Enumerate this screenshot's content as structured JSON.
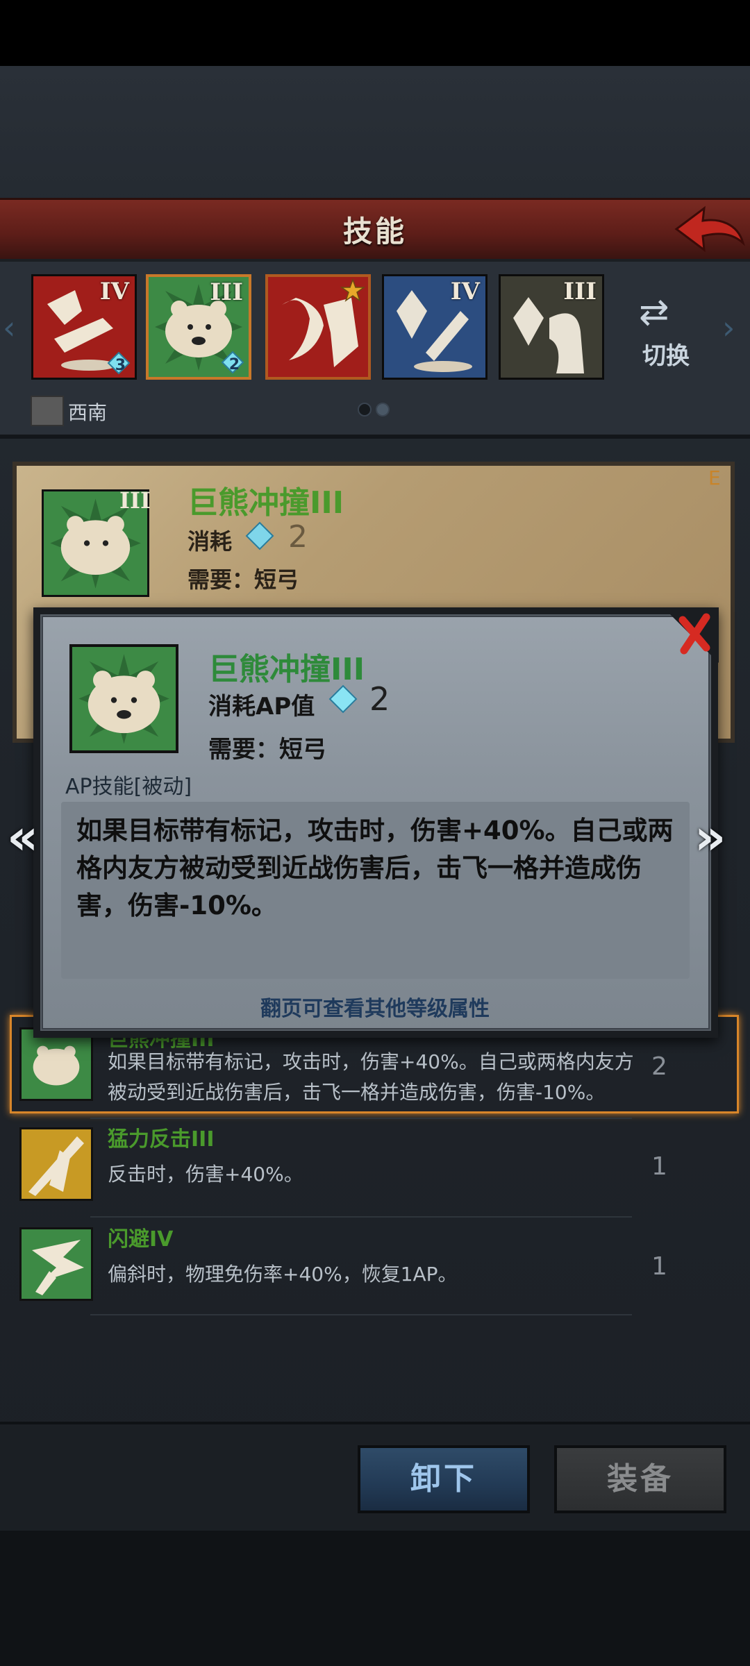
{
  "header": {
    "title": "技能"
  },
  "skill_strip": {
    "slots": [
      {
        "roman": "IV",
        "gem_count": "3",
        "art": "claw-sword"
      },
      {
        "roman": "III",
        "gem_count": "2",
        "art": "bear"
      },
      {
        "roman": "",
        "gem_count": "",
        "art": "claw-fang"
      },
      {
        "roman": "IV",
        "gem_count": "",
        "art": "crystal-sword"
      },
      {
        "roman": "III",
        "gem_count": "",
        "art": "crystal-arm"
      }
    ],
    "switch_label": "切换",
    "region_label": "西南",
    "page_dots": 2,
    "active_dot": 1
  },
  "detail_panel": {
    "title": "巨熊冲撞III",
    "roman": "III",
    "cost_label": "消耗",
    "cost_value": "2",
    "requirement": "需要：短弓",
    "corner_tag": "E"
  },
  "modal": {
    "roman": "III",
    "title": "巨熊冲撞III",
    "cost_label": "消耗AP值",
    "cost_value": "2",
    "requirement": "需要：短弓",
    "type_label": "AP技能[被动]",
    "description": "如果目标带有标记，攻击时，伤害+40%。自己或两格内友方被动受到近战伤害后，击飞一格并造成伤害，伤害-10%。",
    "hint": "翻页可查看其他等级属性"
  },
  "skill_list": [
    {
      "name": "巨熊冲撞III",
      "description": "如果目标带有标记，攻击时，伤害+40%。自己或两格内友方被动受到近战伤害后，击飞一格并造成伤害，伤害-10%。",
      "level": "2",
      "highlight": true
    },
    {
      "name": "猛力反击III",
      "description": "反击时，伤害+40%。",
      "level": "1",
      "highlight": false
    },
    {
      "name": "闪避IV",
      "description": "偏斜时，物理免伤率+40%，恢复1AP。",
      "level": "1",
      "highlight": false
    }
  ],
  "buttons": {
    "unequip": "卸下",
    "equip": "装备"
  },
  "colors": {
    "title_bar": "#6a231d",
    "skill_name_green": "#4a9a2c",
    "highlight_orange": "#d8862a",
    "unequip_blue": "#2f4b68",
    "equip_gray": "#3a3c3e"
  }
}
